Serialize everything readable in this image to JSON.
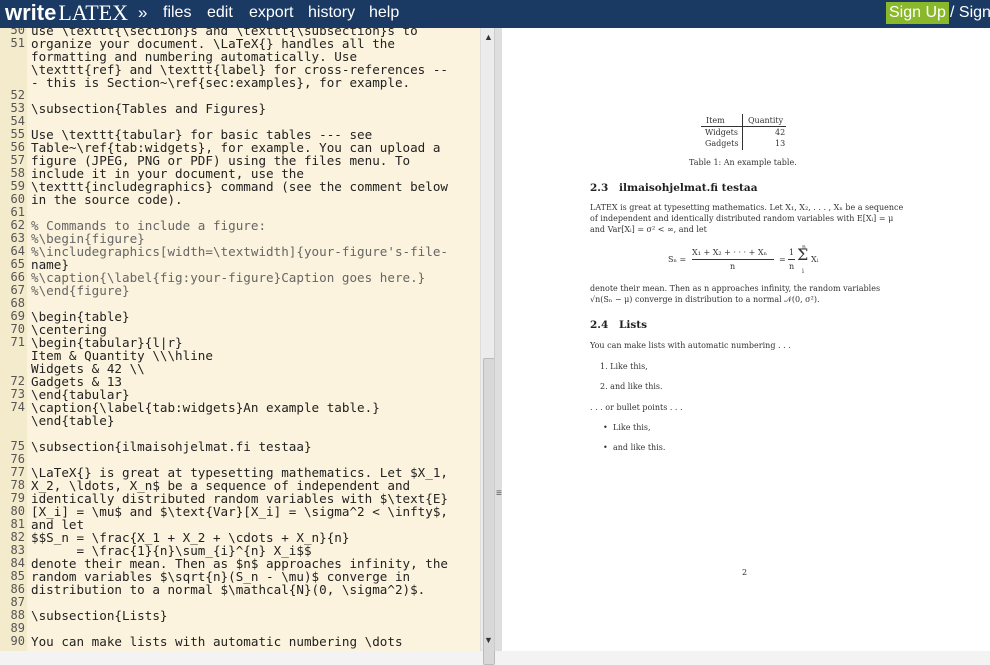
{
  "header": {
    "logo_write": "write",
    "logo_latex": "LATEX",
    "nav_arrow": "»",
    "menu": [
      "files",
      "edit",
      "export",
      "history",
      "help"
    ],
    "signup_label": "Sign Up",
    "signin_label": "/ Sign"
  },
  "editor": {
    "lines": [
      {
        "n": "50",
        "t": "use \\texttt{\\section}s and \\texttt{\\subsection}s to"
      },
      {
        "n": "51",
        "t": "organize your document. \\LaTeX{} handles all the"
      },
      {
        "n": "",
        "t": "formatting and numbering automatically. Use"
      },
      {
        "n": "",
        "t": "\\texttt{ref} and \\texttt{label} for cross-references --"
      },
      {
        "n": "",
        "t": "- this is Section~\\ref{sec:examples}, for example."
      },
      {
        "n": "52",
        "t": ""
      },
      {
        "n": "53",
        "t": "\\subsection{Tables and Figures}"
      },
      {
        "n": "54",
        "t": ""
      },
      {
        "n": "55",
        "t": "Use \\texttt{tabular} for basic tables --- see"
      },
      {
        "n": "56",
        "t": "Table~\\ref{tab:widgets}, for example. You can upload a"
      },
      {
        "n": "57",
        "t": "figure (JPEG, PNG or PDF) using the files menu. To"
      },
      {
        "n": "58",
        "t": "include it in your document, use the"
      },
      {
        "n": "59",
        "t": "\\texttt{includegraphics} command (see the comment below"
      },
      {
        "n": "60",
        "t": "in the source code)."
      },
      {
        "n": "61",
        "t": ""
      },
      {
        "n": "62",
        "t": "% Commands to include a figure:"
      },
      {
        "n": "63",
        "t": "%\\begin{figure}"
      },
      {
        "n": "64",
        "t": "%\\includegraphics[width=\\textwidth]{your-figure's-file-"
      },
      {
        "n": "65",
        "t": "name}"
      },
      {
        "n": "66",
        "t": "%\\caption{\\label{fig:your-figure}Caption goes here.}"
      },
      {
        "n": "67",
        "t": "%\\end{figure}"
      },
      {
        "n": "68",
        "t": ""
      },
      {
        "n": "69",
        "t": "\\begin{table}"
      },
      {
        "n": "70",
        "t": "\\centering"
      },
      {
        "n": "71",
        "t": "\\begin{tabular}{l|r}"
      },
      {
        "n": "",
        "t": "Item & Quantity \\\\\\hline"
      },
      {
        "n": "",
        "t": "Widgets & 42 \\\\"
      },
      {
        "n": "72",
        "t": "Gadgets & 13"
      },
      {
        "n": "73",
        "t": "\\end{tabular}"
      },
      {
        "n": "74",
        "t": "\\caption{\\label{tab:widgets}An example table.}"
      },
      {
        "n": "",
        "t": "\\end{table}"
      },
      {
        "n": "",
        "t": ""
      },
      {
        "n": "75",
        "t": "\\subsection{ilmaisohjelmat.fi testaa}"
      },
      {
        "n": "76",
        "t": ""
      },
      {
        "n": "77",
        "t": "\\LaTeX{} is great at typesetting mathematics. Let $X_1,"
      },
      {
        "n": "78",
        "t": "X_2, \\ldots, X_n$ be a sequence of independent and"
      },
      {
        "n": "79",
        "t": "identically distributed random variables with $\\text{E}"
      },
      {
        "n": "80",
        "t": "[X_i] = \\mu$ and $\\text{Var}[X_i] = \\sigma^2 < \\infty$,"
      },
      {
        "n": "81",
        "t": "and let"
      },
      {
        "n": "82",
        "t": "$$S_n = \\frac{X_1 + X_2 + \\cdots + X_n}{n}"
      },
      {
        "n": "83",
        "t": "      = \\frac{1}{n}\\sum_{i}^{n} X_i$$"
      },
      {
        "n": "84",
        "t": "denote their mean. Then as $n$ approaches infinity, the"
      },
      {
        "n": "85",
        "t": "random variables $\\sqrt{n}(S_n - \\mu)$ converge in"
      },
      {
        "n": "86",
        "t": "distribution to a normal $\\mathcal{N}(0, \\sigma^2)$."
      },
      {
        "n": "87",
        "t": ""
      },
      {
        "n": "88",
        "t": "\\subsection{Lists}"
      },
      {
        "n": "89",
        "t": ""
      },
      {
        "n": "90",
        "t": "You can make lists with automatic numbering \\dots"
      }
    ]
  },
  "preview": {
    "table_head_item": "Item",
    "table_head_qty": "Quantity",
    "row1_item": "Widgets",
    "row1_qty": "42",
    "row2_item": "Gadgets",
    "row2_qty": "13",
    "table_caption": "Table 1: An example table.",
    "sec23_num": "2.3",
    "sec23_title": "ilmaisohjelmat.fi testaa",
    "para1_l1": "LATEX is great at typesetting mathematics. Let X₁, X₂, . . . , Xₙ be a sequence",
    "para1_l2": "of independent and identically distributed random variables with E[Xᵢ] = μ",
    "para1_l3": "and Var[Xᵢ] = σ² < ∞, and let",
    "eq_lhs": "Sₙ =",
    "eq_num": "X₁ + X₂ + · · · + Xₙ",
    "eq_den": "n",
    "eq_mid": "=",
    "eq_frac_num": "1",
    "eq_frac_den": "n",
    "eq_sum": "Σ",
    "eq_sum_top": "n",
    "eq_sum_bot": "i",
    "eq_xi": "Xᵢ",
    "para2_l1": "denote their mean.  Then as n approaches infinity, the random variables",
    "para2_l2": "√n(Sₙ − μ) converge in distribution to a normal 𝒩(0, σ²).",
    "sec24_num": "2.4",
    "sec24_title": "Lists",
    "lists_intro": "You can make lists with automatic numbering . . .",
    "num_item1": "1.  Like this,",
    "num_item2": "2.  and like this.",
    "bullet_intro": ". . . or bullet points . . .",
    "bullet1": "Like this,",
    "bullet2": "and like this.",
    "page_number": "2"
  }
}
